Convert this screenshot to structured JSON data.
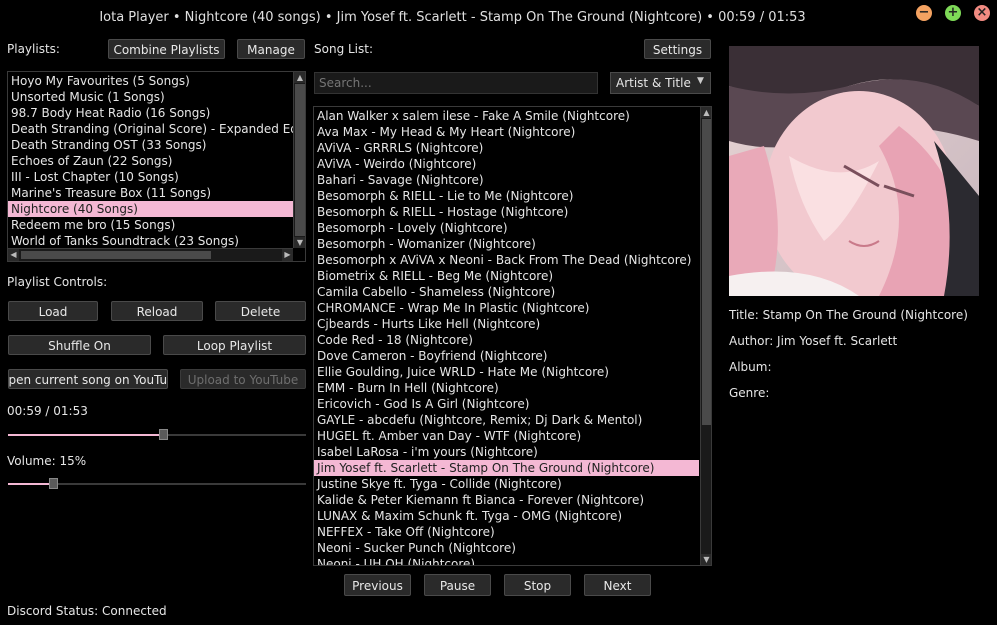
{
  "window": {
    "title": "Iota Player • Nightcore (40 songs) • Jim Yosef ft. Scarlett - Stamp On The Ground (Nightcore) • 00:59 / 01:53",
    "buttons": {
      "minimize": "−",
      "maximize": "+",
      "close": "×"
    },
    "colors": {
      "minimize": "#f4a261",
      "maximize": "#7ed957",
      "close": "#f28b82"
    }
  },
  "playlists": {
    "label": "Playlists:",
    "combine_label": "Combine Playlists",
    "manage_label": "Manage",
    "items": [
      "Hoyo My Favourites (5 Songs)",
      "Unsorted Music (1 Songs)",
      "98.7 Body Heat Radio (16 Songs)",
      "Death Stranding (Original Score) - Expanded Edit",
      "Death Stranding OST (33 Songs)",
      "Echoes of Zaun (22 Songs)",
      "III - Lost Chapter (10 Songs)",
      "Marine's Treasure Box (11 Songs)",
      "Nightcore (40 Songs)",
      "Redeem me bro (15 Songs)",
      "World of Tanks Soundtrack (23 Songs)"
    ],
    "selected_index": 8
  },
  "controls": {
    "label": "Playlist Controls:",
    "load": "Load",
    "reload": "Reload",
    "delete": "Delete",
    "shuffle": "Shuffle On",
    "loop": "Loop Playlist",
    "open_youtube": "Open current song on YouTube",
    "upload_youtube": "Upload to YouTube"
  },
  "playback": {
    "time_label": "00:59 / 01:53",
    "progress": 0.52,
    "volume_label": "Volume: 15%",
    "volume": 0.15
  },
  "discord": {
    "status": "Discord Status: Connected"
  },
  "songs": {
    "label": "Song List:",
    "settings_label": "Settings",
    "search_placeholder": "Search...",
    "sort_value": "Artist & Title",
    "items": [
      "Alan Walker x salem ilese - Fake A Smile (Nightcore)",
      "Ava Max - My Head & My Heart (Nightcore)",
      "AViVA - GRRRLS (Nightcore)",
      "AViVA - Weirdo (Nightcore)",
      "Bahari - Savage (Nightcore)",
      "Besomorph & RIELL - Lie to Me (Nightcore)",
      "Besomorph & RIELL - Hostage (Nightcore)",
      "Besomorph - Lovely (Nightcore)",
      "Besomorph - Womanizer (Nightcore)",
      "Besomorph x AViVA x Neoni - Back From The Dead (Nightcore)",
      "Biometrix & RIELL - Beg Me (Nightcore)",
      "Camila Cabello - Shameless (Nightcore)",
      "CHROMANCE - Wrap Me In Plastic (Nightcore)",
      "Cjbeards - Hurts Like Hell (Nightcore)",
      "Code Red - 18 (Nightcore)",
      "Dove Cameron - Boyfriend (Nightcore)",
      "Ellie Goulding, Juice WRLD - Hate Me (Nightcore)",
      "EMM - Burn In Hell (Nightcore)",
      "Ericovich - God Is A Girl (Nightcore)",
      "GAYLE - abcdefu (Nightcore, Remix; Dj Dark & Mentol)",
      "HUGEL ft. Amber van Day - WTF (Nightcore)",
      "Isabel LaRosa - i'm yours (Nightcore)",
      "Jim Yosef ft. Scarlett - Stamp On The Ground (Nightcore)",
      "Justine Skye ft. Tyga - Collide (Nightcore)",
      "Kalide & Peter Kiemann ft Bianca - Forever (Nightcore)",
      "LUNAX & Maxim Schunk ft. Tyga - OMG (Nightcore)",
      "NEFFEX - Take Off (Nightcore)",
      "Neoni - Sucker Punch (Nightcore)",
      "Neoni - UH OH (Nightcore)"
    ],
    "selected_index": 22
  },
  "transport": {
    "previous": "Previous",
    "pause": "Pause",
    "stop": "Stop",
    "next": "Next"
  },
  "info": {
    "title": "Title: Stamp On The Ground (Nightcore)",
    "author": "Author: Jim Yosef ft. Scarlett",
    "album": "Album:",
    "genre": "Genre:"
  },
  "theme": {
    "accent": "#f4b8d4"
  }
}
